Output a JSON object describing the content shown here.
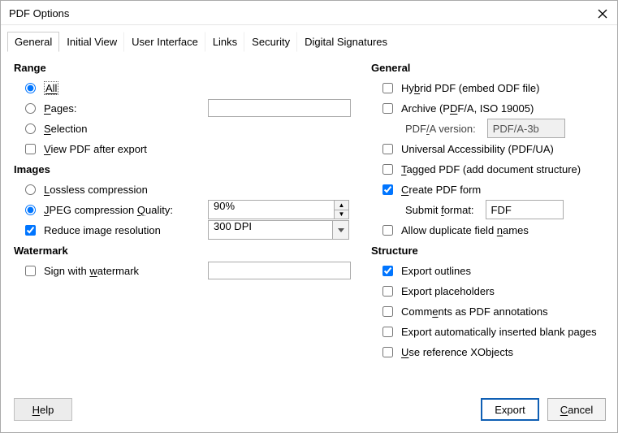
{
  "title": "PDF Options",
  "tabs": {
    "general": "General",
    "initial_view": "Initial View",
    "user_interface": "User Interface",
    "links": "Links",
    "security": "Security",
    "digital_signatures": "Digital Signatures"
  },
  "range": {
    "heading": "Range",
    "all": "All",
    "pages_label_pre": "",
    "pages_label_key": "P",
    "pages_label_post": "ages:",
    "pages_value": "",
    "selection_pre": "",
    "selection_key": "S",
    "selection_post": "election",
    "view_pdf_pre": "",
    "view_pdf_key": "V",
    "view_pdf_post": "iew PDF after export"
  },
  "images": {
    "heading": "Images",
    "lossless_pre": "",
    "lossless_key": "L",
    "lossless_post": "ossless compression",
    "jpeg_pre": "",
    "jpeg_key": "J",
    "jpeg_mid": "PEG compression ",
    "jpeg_quality_key": "Q",
    "jpeg_quality_post": "uality:",
    "quality_value": "90%",
    "reduce_label": "Reduce image resolution",
    "resolution_value": "300 DPI"
  },
  "watermark": {
    "heading": "Watermark",
    "sign_pre": "Sign with ",
    "sign_key": "w",
    "sign_post": "atermark",
    "value": ""
  },
  "general": {
    "heading": "General",
    "hybrid_pre": "Hy",
    "hybrid_key": "b",
    "hybrid_post": "rid PDF (embed ODF file)",
    "archive_pre": "Archive (P",
    "archive_key": "D",
    "archive_post": "F/A, ISO 19005)",
    "pdfa_label_pre": "PDF",
    "pdfa_label_key": "/",
    "pdfa_label_post": "A version:",
    "pdfa_value": "PDF/A-3b",
    "universal": "Universal Accessibility (PDF/UA)",
    "tagged_pre": "",
    "tagged_key": "T",
    "tagged_post": "agged PDF (add document structure)",
    "create_form_pre": "",
    "create_form_key": "C",
    "create_form_post": "reate PDF form",
    "submit_label_pre": "Submit ",
    "submit_label_key": "f",
    "submit_label_post": "ormat:",
    "submit_value": "FDF",
    "allow_dup_pre": "Allow duplicate field ",
    "allow_dup_key": "n",
    "allow_dup_post": "ames"
  },
  "structure": {
    "heading": "Structure",
    "export_outlines": "Export outlines",
    "export_placeholders": "Export placeholders",
    "comments_pre": "Comm",
    "comments_key": "e",
    "comments_post": "nts as PDF annotations",
    "export_auto": "Export automatically inserted blank pages",
    "use_ref_pre": "",
    "use_ref_key": "U",
    "use_ref_post": "se reference XObjects"
  },
  "footer": {
    "help_pre": "",
    "help_key": "H",
    "help_post": "elp",
    "export": "Export",
    "cancel_pre": "",
    "cancel_key": "C",
    "cancel_post": "ancel"
  }
}
